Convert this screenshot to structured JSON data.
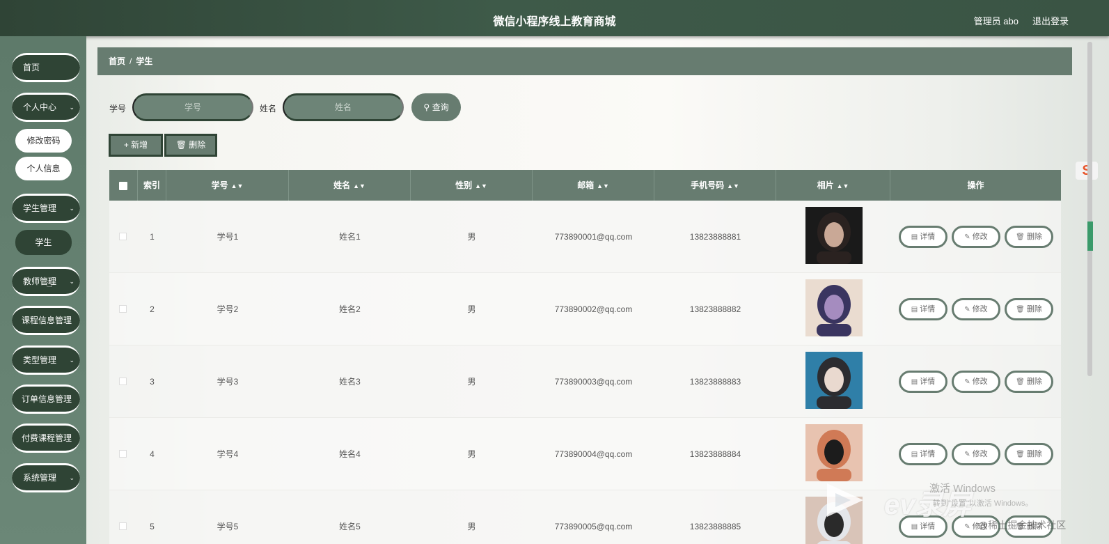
{
  "header": {
    "title": "微信小程序线上教育商城",
    "user": "管理员 abo",
    "logout": "退出登录"
  },
  "sidebar": {
    "home": "首页",
    "personal": {
      "label": "个人中心",
      "children": [
        "修改密码",
        "个人信息"
      ]
    },
    "student": {
      "label": "学生管理",
      "children": [
        "学生"
      ]
    },
    "teacher": "教师管理",
    "course": "课程信息管理",
    "type": "类型管理",
    "order": "订单信息管理",
    "paid": "付费课程管理",
    "system": "系统管理"
  },
  "breadcrumb": {
    "home": "首页",
    "sep": "/",
    "current": "学生"
  },
  "search": {
    "id_label": "学号",
    "id_placeholder": "学号",
    "name_label": "姓名",
    "name_placeholder": "姓名",
    "button": "查询"
  },
  "actions": {
    "add": "新增",
    "delete": "删除"
  },
  "table": {
    "headers": [
      "索引",
      "学号",
      "姓名",
      "性别",
      "邮箱",
      "手机号码",
      "相片",
      "操作"
    ],
    "rows": [
      {
        "index": "1",
        "id": "学号1",
        "name": "姓名1",
        "gender": "男",
        "email": "773890001@qq.com",
        "phone": "13823888881"
      },
      {
        "index": "2",
        "id": "学号2",
        "name": "姓名2",
        "gender": "男",
        "email": "773890002@qq.com",
        "phone": "13823888882"
      },
      {
        "index": "3",
        "id": "学号3",
        "name": "姓名3",
        "gender": "男",
        "email": "773890003@qq.com",
        "phone": "13823888883"
      },
      {
        "index": "4",
        "id": "学号4",
        "name": "姓名4",
        "gender": "男",
        "email": "773890004@qq.com",
        "phone": "13823888884"
      },
      {
        "index": "5",
        "id": "学号5",
        "name": "姓名5",
        "gender": "男",
        "email": "773890005@qq.com",
        "phone": "13823888885"
      }
    ],
    "row_buttons": {
      "detail": "详情",
      "edit": "修改",
      "delete": "删除"
    }
  },
  "watermark": {
    "line1": "激活 Windows",
    "line2": "转到\"设置\"以激活 Windows。",
    "line3": "@稀土掘金技术社区",
    "ev": "ev录屏"
  }
}
